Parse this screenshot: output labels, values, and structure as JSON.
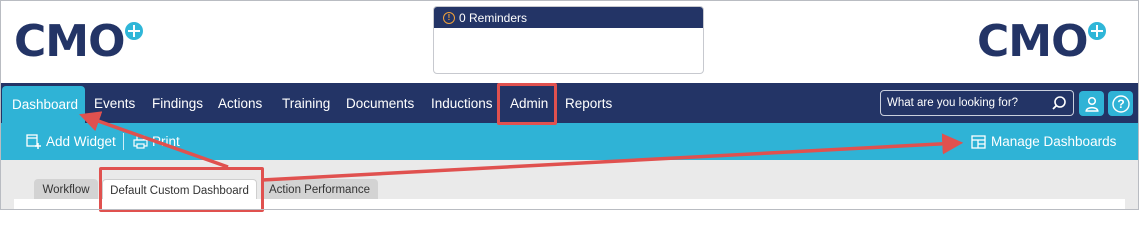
{
  "header": {
    "logo_text": "CMO",
    "reminders": {
      "label": "0 Reminders",
      "icon": "info-icon"
    }
  },
  "navbar": {
    "items": [
      {
        "label": "Dashboard",
        "active": true
      },
      {
        "label": "Events"
      },
      {
        "label": "Findings"
      },
      {
        "label": "Actions"
      },
      {
        "label": "Training"
      },
      {
        "label": "Documents"
      },
      {
        "label": "Inductions"
      },
      {
        "label": "Admin",
        "highlighted": true
      },
      {
        "label": "Reports"
      }
    ],
    "search": {
      "placeholder": "What are you looking for?"
    },
    "buttons": [
      {
        "icon": "user-icon"
      },
      {
        "icon": "help-icon",
        "label": "?"
      }
    ]
  },
  "toolbar": {
    "add_widget": "Add Widget",
    "print": "Print",
    "manage_dashboards": "Manage Dashboards"
  },
  "tabs": [
    {
      "label": "Workflow"
    },
    {
      "label": "Default Custom Dashboard",
      "selected": true
    },
    {
      "label": "Action Performance"
    }
  ],
  "colors": {
    "navy": "#233466",
    "accent": "#2fb3d6",
    "annotation": "#e0514f"
  }
}
